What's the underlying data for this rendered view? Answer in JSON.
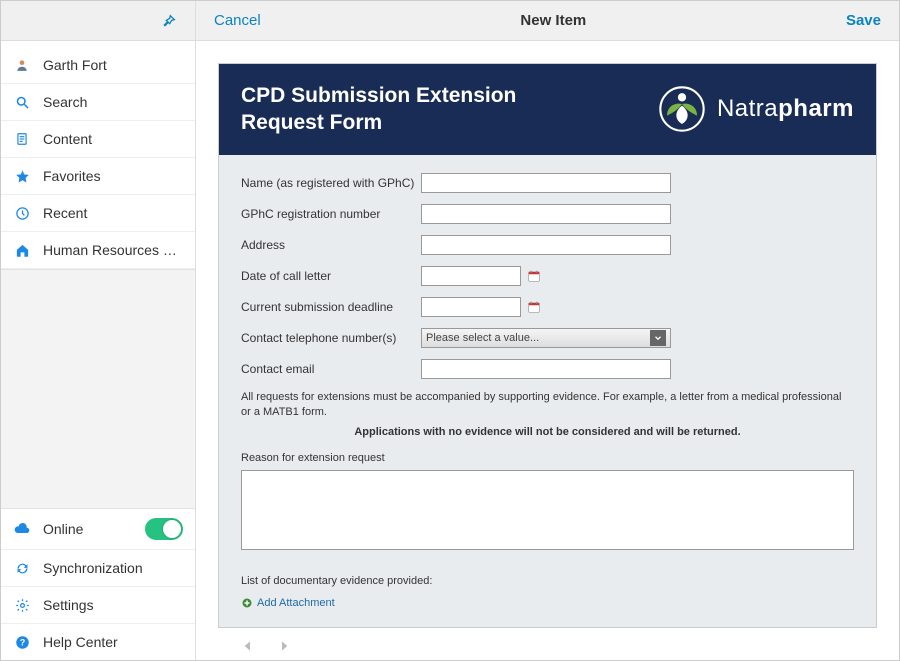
{
  "topbar": {
    "cancel": "Cancel",
    "title": "New Item",
    "save": "Save"
  },
  "sidebar": {
    "items": [
      {
        "label": "Garth Fort"
      },
      {
        "label": "Search"
      },
      {
        "label": "Content"
      },
      {
        "label": "Favorites"
      },
      {
        "label": "Recent"
      },
      {
        "label": "Human Resources W…"
      }
    ],
    "bottom": [
      {
        "label": "Online"
      },
      {
        "label": "Synchronization"
      },
      {
        "label": "Settings"
      },
      {
        "label": "Help Center"
      }
    ]
  },
  "brand": {
    "light": "Natra",
    "bold": "pharm"
  },
  "form": {
    "title": "CPD Submission Extension Request Form",
    "fields": {
      "name": "Name (as registered with GPhC)",
      "reg": "GPhC registration number",
      "address": "Address",
      "letter_date": "Date of call letter",
      "deadline": "Current submission deadline",
      "phone": "Contact telephone number(s)",
      "email": "Contact email"
    },
    "select_placeholder": "Please select a value...",
    "info": "All requests for extensions must be accompanied by supporting evidence. For example, a letter from a medical professional or a MATB1 form.",
    "warning": "Applications with no evidence will not be considered and will be returned.",
    "reason_label": "Reason for extension request",
    "evidence_label": "List of documentary evidence provided:",
    "add_attachment": "Add Attachment"
  }
}
